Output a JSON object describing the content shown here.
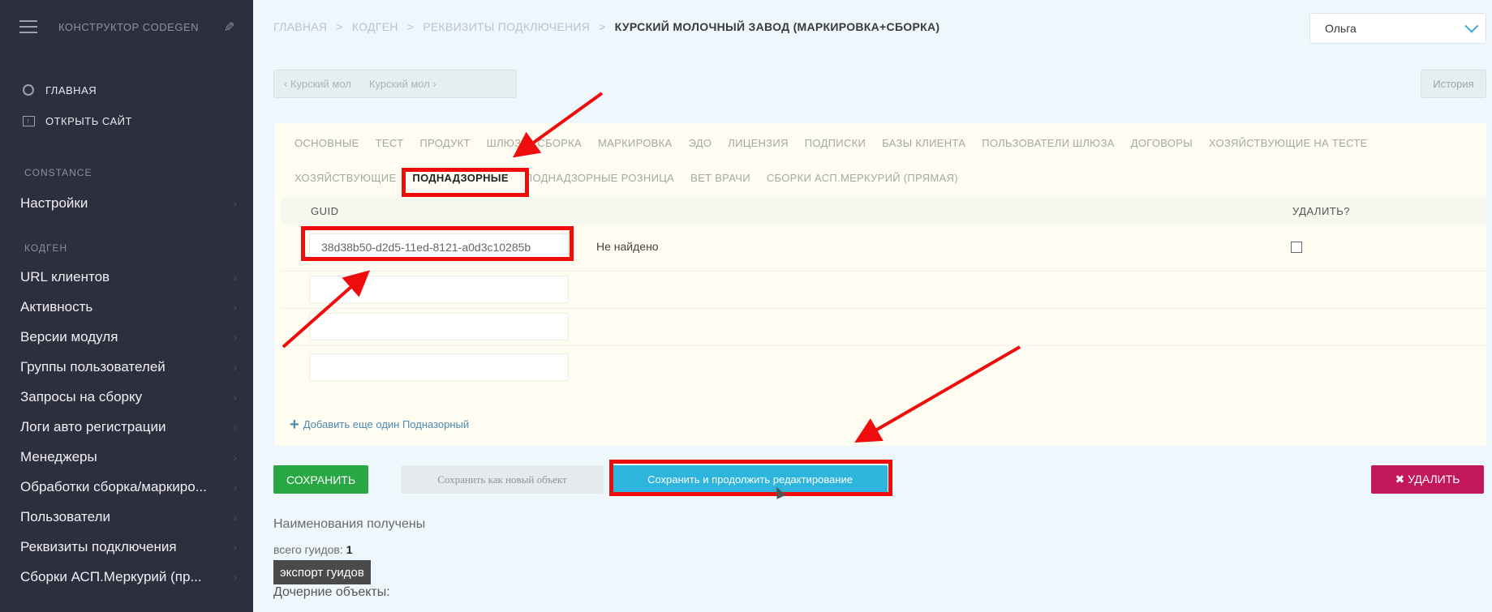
{
  "sidebar": {
    "brand": "КОНСТРУКТОР CODEGEN",
    "top_links": [
      {
        "label": "ГЛАВНАЯ"
      },
      {
        "label": "ОТКРЫТЬ САЙТ"
      }
    ],
    "sections": [
      {
        "title": "CONSTANCE",
        "items": [
          "Настройки"
        ]
      },
      {
        "title": "КОДГЕН",
        "items": [
          "URL клиентов",
          "Активность",
          "Версии модуля",
          "Группы пользователей",
          "Запросы на сборку",
          "Логи авто регистрации",
          "Менеджеры",
          "Обработки сборка/маркиро...",
          "Пользователи",
          "Реквизиты подключения",
          "Сборки АСП.Меркурий (пр..."
        ]
      }
    ]
  },
  "breadcrumb": {
    "items": [
      "ГЛАВНАЯ",
      "КОДГЕН",
      "РЕКВИЗИТЫ ПОДКЛЮЧЕНИЯ"
    ],
    "current": "КУРСКИЙ МОЛОЧНЫЙ ЗАВОД (МАРКИРОВКА+СБОРКА)",
    "separator": ">"
  },
  "user": {
    "name": "Ольга"
  },
  "nav": {
    "prev": "‹ Курский мол",
    "next": "Курский мол ›",
    "history": "История"
  },
  "tabs": {
    "row1": [
      "ОСНОВНЫЕ",
      "ТЕСТ",
      "ПРОДУКТ",
      "ШЛЮЗ",
      "СБОРКА",
      "МАРКИРОВКА",
      "ЭДО",
      "ЛИЦЕНЗИЯ",
      "ПОДПИСКИ",
      "БАЗЫ КЛИЕНТА",
      "ПОЛЬЗОВАТЕЛИ ШЛЮЗА",
      "ДОГОВОРЫ",
      "ХОЗЯЙСТВУЮЩИЕ НА ТЕСТЕ"
    ],
    "row2": [
      "ХОЗЯЙСТВУЮЩИЕ",
      "ПОДНАДЗОРНЫЕ",
      "ПОДНАДЗОРНЫЕ РОЗНИЦА",
      "ВЕТ ВРАЧИ",
      "СБОРКИ АСП.МЕРКУРИЙ (ПРЯМАЯ)"
    ],
    "active": "ПОДНАДЗОРНЫЕ"
  },
  "table": {
    "col_guid": "GUID",
    "col_delete": "УДАЛИТЬ?",
    "rows": [
      {
        "guid": "38d38b50-d2d5-11ed-8121-a0d3c10285b",
        "status": "Не найдено",
        "delete": false
      }
    ],
    "empty_rows": 3,
    "add_label": "Добавить еще один Подназорный"
  },
  "buttons": {
    "save": "СОХРАНИТЬ",
    "save_as_new": "Сохранить как новый объект",
    "save_continue": "Сохранить и продолжить редактирование",
    "delete": "✖ УДАЛИТЬ"
  },
  "info": {
    "names_received": "Наименования получены",
    "total_label": "всего гуидов: ",
    "total_value": "1",
    "export": "экспорт гуидов",
    "children": "Дочерние объекты:"
  },
  "colors": {
    "sidebar_bg": "#2e2f3e",
    "annotation": "#ee0c0c",
    "save": "#28a745",
    "continue": "#2db5de",
    "delete": "#c2185b"
  }
}
